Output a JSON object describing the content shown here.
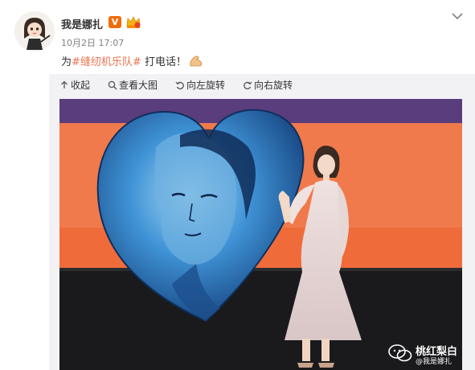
{
  "post": {
    "username": "我是娜扎",
    "verified_badge": "V",
    "timestamp": "10月2日 17:07",
    "text_prefix": "为",
    "topic": "#缝纫机乐队#",
    "text_suffix": " 打电话！",
    "emoji": "muscle-emoji"
  },
  "toolbar": {
    "collapse_label": "收起",
    "view_large_label": "查看大图",
    "rotate_left_label": "向左旋转",
    "rotate_right_label": "向右旋转"
  },
  "watermark": {
    "title": "桃红梨白",
    "subtitle": "@我是娜扎"
  },
  "colors": {
    "accent_link": "#eb7350",
    "verified_orange": "#f26b0a",
    "panel_bg": "#f2f2f5",
    "stage_orange": "#f07a4c",
    "stage_purple": "#5a3d7d",
    "heart_blue": "#3d8fd0"
  },
  "icons": {
    "dropdown": "chevron-down-icon",
    "crown": "crown-icon",
    "collapse": "arrow-up-icon",
    "view_large": "magnifier-icon",
    "rotate_left": "rotate-left-icon",
    "rotate_right": "rotate-right-icon",
    "watermark": "wechat-icon"
  }
}
